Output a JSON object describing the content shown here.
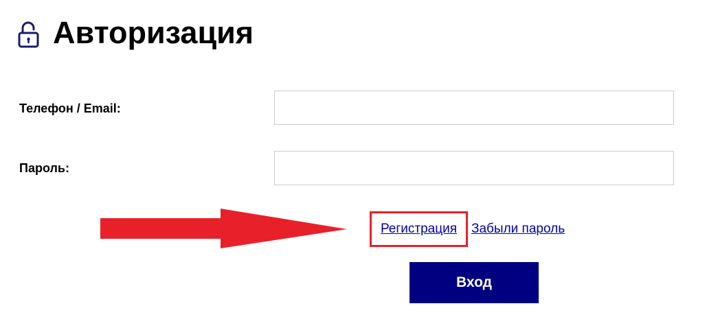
{
  "header": {
    "title": "Авторизация",
    "icon": "lock-open-icon"
  },
  "form": {
    "login_label": "Телефон / Email:",
    "login_value": "",
    "password_label": "Пароль:",
    "password_value": ""
  },
  "links": {
    "register": "Регистрация",
    "forgot_password": "Забыли пароль"
  },
  "actions": {
    "login_button": "Вход"
  },
  "colors": {
    "button_bg": "#000080",
    "link": "#0000a8",
    "annotation_red": "#e8202a",
    "input_border": "#cccccc"
  }
}
